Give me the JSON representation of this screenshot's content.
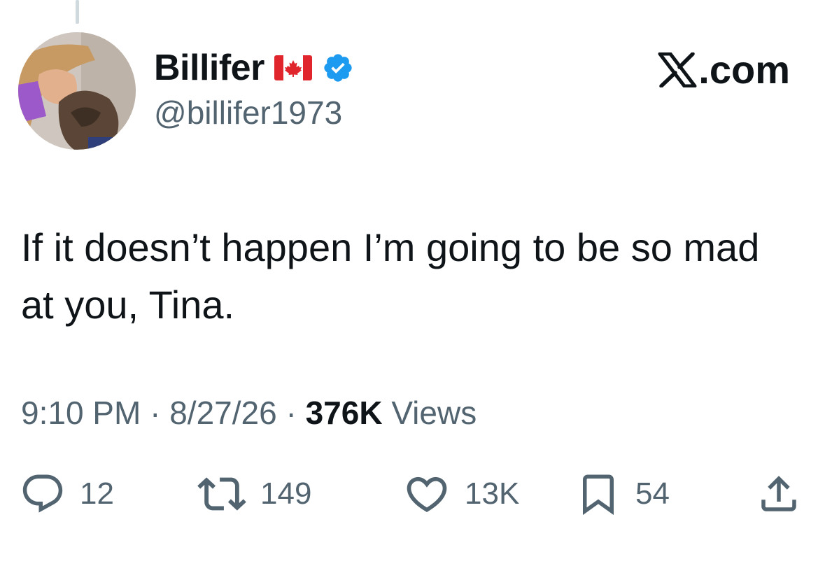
{
  "tweet": {
    "display_name": "Billifer",
    "handle": "@billifer1973",
    "text": "If it doesn’t happen I’m going to be so mad at you, Tina.",
    "time": "9:10 PM",
    "date": "8/27/26",
    "views_count": "376K",
    "views_label": "Views",
    "separator": "·"
  },
  "brand": {
    "label": ".com"
  },
  "actions": {
    "replies": "12",
    "reposts": "149",
    "likes": "13K",
    "bookmarks": "54"
  },
  "icons": {
    "avatar": "profile-photo-avatar",
    "flag": "canada-flag-icon",
    "verified": "verified-badge-icon",
    "brand": "x-logo-icon",
    "reply": "reply-icon",
    "repost": "repost-icon",
    "like": "heart-icon",
    "bookmark": "bookmark-icon",
    "share": "share-icon"
  },
  "colors": {
    "text": "#0f1419",
    "secondary": "#536471",
    "verified": "#1d9bf0",
    "flag_red": "#e0252c",
    "thread_line": "#cfd9de"
  }
}
